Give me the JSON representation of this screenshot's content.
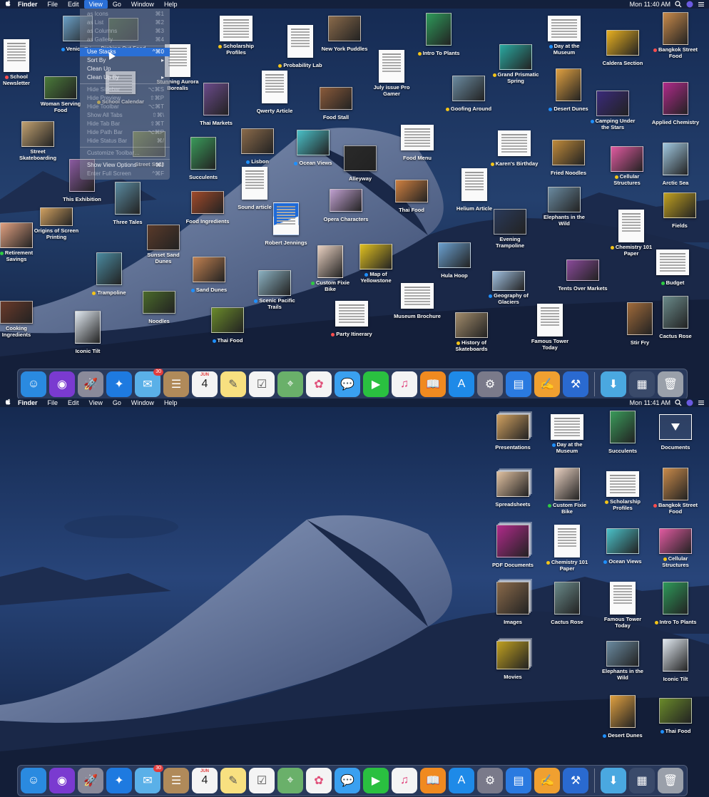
{
  "colors": {
    "tag_yellow": "#f5c518",
    "tag_blue": "#1e90ff",
    "tag_red": "#ff4d4d",
    "tag_green": "#2ecc40",
    "menu_highlight": "#2a6fd6"
  },
  "top": {
    "menubar": {
      "apple": "",
      "app": "Finder",
      "items": [
        "File",
        "Edit",
        "View",
        "Go",
        "Window",
        "Help"
      ],
      "clock": "Mon 11:40 AM"
    },
    "view_menu": [
      {
        "label": "as Icons",
        "shortcut": "⌘1",
        "dim": true
      },
      {
        "label": "as List",
        "shortcut": "⌘2",
        "dim": true
      },
      {
        "label": "as Columns",
        "shortcut": "⌘3",
        "dim": true
      },
      {
        "label": "as Gallery",
        "shortcut": "⌘4",
        "dim": true
      },
      {
        "label": "Use Stacks",
        "shortcut": "^⌘0",
        "dim": false,
        "hl": true
      },
      {
        "label": "Sort By",
        "shortcut": "▸",
        "dim": false
      },
      {
        "label": "Clean Up",
        "shortcut": "",
        "dim": false
      },
      {
        "label": "Clean Up By",
        "shortcut": "▸",
        "dim": false
      },
      {
        "label": "Hide Sidebar",
        "shortcut": "⌥⌘S",
        "dim": true
      },
      {
        "label": "Hide Preview",
        "shortcut": "⇧⌘P",
        "dim": true
      },
      {
        "label": "Hide Toolbar",
        "shortcut": "⌥⌘T",
        "dim": true
      },
      {
        "label": "Show All Tabs",
        "shortcut": "⇧⌘\\",
        "dim": true
      },
      {
        "label": "Hide Tab Bar",
        "shortcut": "⇧⌘T",
        "dim": true
      },
      {
        "label": "Hide Path Bar",
        "shortcut": "⌥⌘P",
        "dim": true
      },
      {
        "label": "Hide Status Bar",
        "shortcut": "⌘/",
        "dim": true
      },
      {
        "label": "Customize Toolbar…",
        "shortcut": "",
        "dim": true
      },
      {
        "label": "Show View Options",
        "shortcut": "⌘J",
        "dim": false
      },
      {
        "label": "Enter Full Screen",
        "shortcut": "^⌘F",
        "dim": true
      }
    ],
    "icons": [
      {
        "label": "School Newsletter",
        "tag": "red",
        "kind": "doc"
      },
      {
        "label": "Venice Trip",
        "tag": "blue",
        "kind": "photo",
        "color": "#6aa0c8"
      },
      {
        "label": "Dishing Out Food",
        "tag": "",
        "kind": "photo",
        "color": "#3a5b2e"
      },
      {
        "label": "Stunning Aurora Borealis",
        "tag": "",
        "kind": "doc"
      },
      {
        "label": "Scholarship Profiles",
        "tag": "yellow",
        "kind": "doc"
      },
      {
        "label": "Probability Lab",
        "tag": "yellow",
        "kind": "doc"
      },
      {
        "label": "New York Puddles",
        "tag": "",
        "kind": "photo",
        "color": "#8a6a4a"
      },
      {
        "label": "Intro To Plants",
        "tag": "yellow",
        "kind": "photo",
        "color": "#2e9a5a"
      },
      {
        "label": "Day at the Museum",
        "tag": "blue",
        "kind": "doc"
      },
      {
        "label": "Caldera Section",
        "tag": "",
        "kind": "photo",
        "color": "#e8b020"
      },
      {
        "label": "Bangkok Street Food",
        "tag": "red",
        "kind": "photo",
        "color": "#c98a4a"
      },
      {
        "label": "Woman Serving Food",
        "tag": "",
        "kind": "photo",
        "color": "#4a7a3a"
      },
      {
        "label": "School Calendar",
        "tag": "yellow",
        "kind": "doc"
      },
      {
        "label": "Thai Markets",
        "tag": "",
        "kind": "photo",
        "color": "#6a4a8a"
      },
      {
        "label": "Qwerty Article",
        "tag": "",
        "kind": "doc"
      },
      {
        "label": "Food Stall",
        "tag": "",
        "kind": "photo",
        "color": "#8a5a3a"
      },
      {
        "label": "July issue Pro Gamer",
        "tag": "",
        "kind": "doc"
      },
      {
        "label": "Grand Prismatic Spring",
        "tag": "yellow",
        "kind": "photo",
        "color": "#2aa8a0"
      },
      {
        "label": "Goofing Around",
        "tag": "yellow",
        "kind": "photo",
        "color": "#6a8aa0"
      },
      {
        "label": "Desert Dunes",
        "tag": "blue",
        "kind": "photo",
        "color": "#e0a040"
      },
      {
        "label": "Camping Under the Stars",
        "tag": "blue",
        "kind": "photo",
        "color": "#3a2a7a"
      },
      {
        "label": "Applied Chemistry",
        "tag": "",
        "kind": "photo",
        "color": "#b02a8a"
      },
      {
        "label": "Street Skateboarding",
        "tag": "",
        "kind": "photo",
        "color": "#c0a070"
      },
      {
        "label": "Street Stall",
        "tag": "",
        "kind": "photo",
        "color": "#7a8a3a"
      },
      {
        "label": "Succulents",
        "tag": "",
        "kind": "photo",
        "color": "#3a9a5a"
      },
      {
        "label": "Lisbon",
        "tag": "blue",
        "kind": "photo",
        "color": "#8a6a4a"
      },
      {
        "label": "Ocean Views",
        "tag": "blue",
        "kind": "photo",
        "color": "#4ac0c8"
      },
      {
        "label": "Alleyway",
        "tag": "",
        "kind": "photo",
        "color": "#2a2a2a"
      },
      {
        "label": "Food Menu",
        "tag": "",
        "kind": "doc"
      },
      {
        "label": "Karen's Birthday",
        "tag": "yellow",
        "kind": "doc"
      },
      {
        "label": "Fried Noodles",
        "tag": "",
        "kind": "photo",
        "color": "#c08a3a"
      },
      {
        "label": "Cellular Structures",
        "tag": "yellow",
        "kind": "photo",
        "color": "#e05aa0"
      },
      {
        "label": "Arctic Sea",
        "tag": "",
        "kind": "photo",
        "color": "#a0c8e0"
      },
      {
        "label": "This Exhibition",
        "tag": "",
        "kind": "photo",
        "color": "#8a5aa0"
      },
      {
        "label": "Three Tales",
        "tag": "",
        "kind": "photo",
        "color": "#5a8aa0"
      },
      {
        "label": "Food Ingredients",
        "tag": "",
        "kind": "photo",
        "color": "#a04a2a"
      },
      {
        "label": "Sound article",
        "tag": "",
        "kind": "doc"
      },
      {
        "label": "Opera Characters",
        "tag": "",
        "kind": "photo",
        "color": "#c0a0d0"
      },
      {
        "label": "Thai Food",
        "tag": "",
        "kind": "photo",
        "color": "#d08040"
      },
      {
        "label": "Helium Article",
        "tag": "",
        "kind": "doc"
      },
      {
        "label": "Elephants in the Wild",
        "tag": "",
        "kind": "photo",
        "color": "#6a8aa0"
      },
      {
        "label": "Fields",
        "tag": "",
        "kind": "photo",
        "color": "#c0a020"
      },
      {
        "label": "Origins of Screen Printing",
        "tag": "",
        "kind": "photo",
        "color": "#d0a060"
      },
      {
        "label": "Robert Jennings",
        "tag": "",
        "kind": "pdf"
      },
      {
        "label": "Evening Trampoline",
        "tag": "",
        "kind": "photo",
        "color": "#2a3a5a"
      },
      {
        "label": "Chemistry 101 Paper",
        "tag": "yellow",
        "kind": "doc"
      },
      {
        "label": "Retirement Savings",
        "tag": "green",
        "kind": "photo",
        "color": "#e0a080"
      },
      {
        "label": "Sunset Sand Dunes",
        "tag": "",
        "kind": "photo",
        "color": "#5a3a2a"
      },
      {
        "label": "Trampoline",
        "tag": "yellow",
        "kind": "photo",
        "color": "#4a8aa0"
      },
      {
        "label": "Sand Dunes",
        "tag": "blue",
        "kind": "photo",
        "color": "#c08050"
      },
      {
        "label": "Custom Fixie Bike",
        "tag": "green",
        "kind": "photo",
        "color": "#e8d0c0"
      },
      {
        "label": "Map of Yellowstone",
        "tag": "blue",
        "kind": "photo",
        "color": "#e0c020"
      },
      {
        "label": "Hula Hoop",
        "tag": "",
        "kind": "photo",
        "color": "#6aa0d0"
      },
      {
        "label": "Tents Over Markets",
        "tag": "",
        "kind": "photo",
        "color": "#8a4a9a"
      },
      {
        "label": "Budget",
        "tag": "green",
        "kind": "doc"
      },
      {
        "label": "Scenic Pacific Trails",
        "tag": "blue",
        "kind": "photo",
        "color": "#8ab0c0"
      },
      {
        "label": "Museum Brochure",
        "tag": "",
        "kind": "doc"
      },
      {
        "label": "Geography of Glaciers",
        "tag": "blue",
        "kind": "photo",
        "color": "#a0c0e0"
      },
      {
        "label": "Cooking Ingredients",
        "tag": "",
        "kind": "photo",
        "color": "#6a3a2a"
      },
      {
        "label": "Noodles",
        "tag": "",
        "kind": "photo",
        "color": "#4a6a2a"
      },
      {
        "label": "Iconic Tilt",
        "tag": "",
        "kind": "photo",
        "color": "#e0e8f0"
      },
      {
        "label": "Thai Food",
        "tag": "blue",
        "kind": "photo",
        "color": "#6a8a2a"
      },
      {
        "label": "Party Itinerary",
        "tag": "red",
        "kind": "doc"
      },
      {
        "label": "History of Skateboards",
        "tag": "yellow",
        "kind": "photo",
        "color": "#a08a6a"
      },
      {
        "label": "Famous Tower Today",
        "tag": "",
        "kind": "doc"
      },
      {
        "label": "Stir Fry",
        "tag": "",
        "kind": "photo",
        "color": "#a06a3a"
      },
      {
        "label": "Cactus Rose",
        "tag": "",
        "kind": "photo",
        "color": "#6a8a8a"
      }
    ]
  },
  "bottom": {
    "menubar": {
      "apple": "",
      "app": "Finder",
      "items": [
        "File",
        "Edit",
        "View",
        "Go",
        "Window",
        "Help"
      ],
      "clock": "Mon 11:41 AM"
    },
    "icons": [
      {
        "label": "Presentations",
        "tag": "",
        "kind": "stack",
        "color": "#d0a060"
      },
      {
        "label": "Day at the Museum",
        "tag": "blue",
        "kind": "doc"
      },
      {
        "label": "Succulents",
        "tag": "",
        "kind": "photo",
        "color": "#3a9a5a"
      },
      {
        "label": "Documents",
        "tag": "",
        "kind": "folder"
      },
      {
        "label": "Spreadsheets",
        "tag": "",
        "kind": "stack",
        "color": "#e0c0a0"
      },
      {
        "label": "Custom Fixie Bike",
        "tag": "green",
        "kind": "photo",
        "color": "#e8d0c0"
      },
      {
        "label": "Scholarship Profiles",
        "tag": "yellow",
        "kind": "doc"
      },
      {
        "label": "Bangkok Street Food",
        "tag": "red",
        "kind": "photo",
        "color": "#c98a4a"
      },
      {
        "label": "PDF Documents",
        "tag": "",
        "kind": "stack",
        "color": "#b02a8a"
      },
      {
        "label": "Chemistry 101 Paper",
        "tag": "yellow",
        "kind": "doc"
      },
      {
        "label": "Ocean Views",
        "tag": "blue",
        "kind": "photo",
        "color": "#4ac0c8"
      },
      {
        "label": "Cellular Structures",
        "tag": "yellow",
        "kind": "photo",
        "color": "#e05aa0"
      },
      {
        "label": "Images",
        "tag": "",
        "kind": "stack",
        "color": "#8a6a4a"
      },
      {
        "label": "Cactus Rose",
        "tag": "",
        "kind": "photo",
        "color": "#6a8a8a"
      },
      {
        "label": "Famous Tower Today",
        "tag": "",
        "kind": "doc"
      },
      {
        "label": "Intro To Plants",
        "tag": "yellow",
        "kind": "photo",
        "color": "#2e9a5a"
      },
      {
        "label": "Movies",
        "tag": "",
        "kind": "stack",
        "color": "#c0a020"
      },
      {
        "label": "Elephants in the Wild",
        "tag": "",
        "kind": "photo",
        "color": "#6a8aa0"
      },
      {
        "label": "Iconic Tilt",
        "tag": "",
        "kind": "photo",
        "color": "#e0e8f0"
      },
      {
        "label": "Desert Dunes",
        "tag": "blue",
        "kind": "photo",
        "color": "#e0a040"
      },
      {
        "label": "Thai Food",
        "tag": "blue",
        "kind": "photo",
        "color": "#6a8a2a"
      }
    ]
  },
  "dock": {
    "apps": [
      {
        "name": "finder-icon",
        "color": "#2a8ae0",
        "glyph": "☺"
      },
      {
        "name": "siri-icon",
        "color": "#7a3ad0",
        "glyph": "◉"
      },
      {
        "name": "launchpad-icon",
        "color": "#8a8a9a",
        "glyph": "🚀"
      },
      {
        "name": "safari-icon",
        "color": "#1e7ae0",
        "glyph": "✦"
      },
      {
        "name": "mail-icon",
        "color": "#5ab0e8",
        "glyph": "✉",
        "badge": "30"
      },
      {
        "name": "contacts-icon",
        "color": "#b08a5a",
        "glyph": "☰"
      },
      {
        "name": "calendar-icon",
        "color": "#f4f4f4",
        "glyph": "4",
        "text_color": "#222",
        "label_top": "JUN"
      },
      {
        "name": "notes-icon",
        "color": "#f8e080",
        "glyph": "✎",
        "text_color": "#555"
      },
      {
        "name": "reminders-icon",
        "color": "#f4f4f4",
        "glyph": "☑",
        "text_color": "#555"
      },
      {
        "name": "maps-icon",
        "color": "#6ab06a",
        "glyph": "⌖"
      },
      {
        "name": "photos-icon",
        "color": "#f4f4f4",
        "glyph": "✿",
        "text_color": "#e0507a"
      },
      {
        "name": "messages-icon",
        "color": "#3aa0f0",
        "glyph": "💬"
      },
      {
        "name": "facetime-icon",
        "color": "#2ac040",
        "glyph": "▶"
      },
      {
        "name": "itunes-icon",
        "color": "#f4f4f4",
        "glyph": "♫",
        "text_color": "#e0407a"
      },
      {
        "name": "books-icon",
        "color": "#f08a20",
        "glyph": "📖"
      },
      {
        "name": "app-store-icon",
        "color": "#1e8ae8",
        "glyph": "A"
      },
      {
        "name": "system-preferences-icon",
        "color": "#7a7a8a",
        "glyph": "⚙"
      },
      {
        "name": "keynote-icon",
        "color": "#2a7ae0",
        "glyph": "▤"
      },
      {
        "name": "pages-icon",
        "color": "#f0a030",
        "glyph": "✍"
      },
      {
        "name": "xcode-icon",
        "color": "#2a6ad0",
        "glyph": "⚒"
      }
    ],
    "right": [
      {
        "name": "downloads-folder-icon",
        "color": "#4aa8e0",
        "glyph": "⬇"
      },
      {
        "name": "recent-stack-icon",
        "color": "#3a4a6a",
        "glyph": "▦"
      },
      {
        "name": "trash-icon",
        "color": "#9aa0aa",
        "glyph": "🗑"
      }
    ]
  }
}
